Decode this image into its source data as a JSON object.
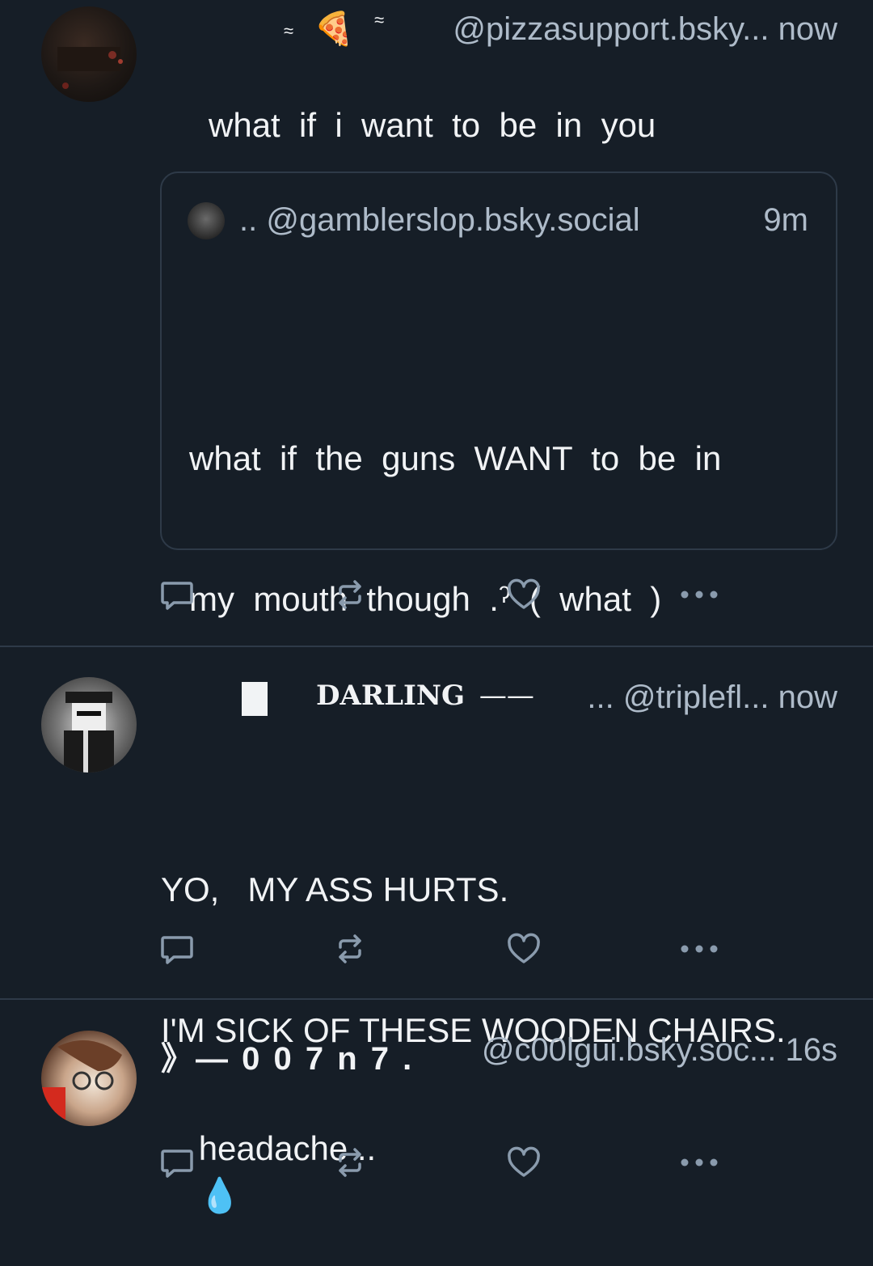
{
  "posts": [
    {
      "display_name_parts": [
        "≈",
        "🍕",
        "≈"
      ],
      "handle": "@pizzasupport.bsky...",
      "time": "now",
      "text": "what  if  i  want  to  be  in  you",
      "quote": {
        "prefix": "..",
        "handle": "@gamblerslop.bsky.social",
        "time": "9m",
        "text_line1": "what  if  the  guns  WANT  to  be  in",
        "text_line2": "my  mouth  though  .ˀ  (  what  )"
      }
    },
    {
      "display_name": "DARLING",
      "display_name_rest": "——",
      "prefix": "...",
      "handle": "@triplefl...",
      "time": "now",
      "text_line1": "YO,   MY ASS HURTS.",
      "text_line2": "I'M SICK OF THESE WOODEN CHAIRS."
    },
    {
      "display_name": "》— 0 0 7 n 7 .",
      "handle": "@c00lgui.bsky.soc...",
      "time": "16s",
      "text": "headache ..",
      "emoji": "💧"
    }
  ],
  "actions": {
    "reply_icon": "reply-icon",
    "repost_icon": "repost-icon",
    "like_icon": "heart-icon",
    "more_icon": "more-icon"
  },
  "colors": {
    "background": "#161e27",
    "divider": "#2e3a48",
    "muted_text": "#aebbc9",
    "icon": "#8a9bad"
  }
}
